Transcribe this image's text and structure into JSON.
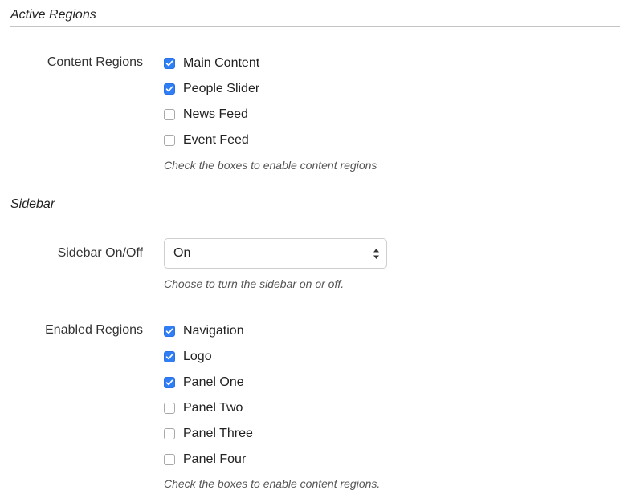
{
  "active_regions": {
    "title": "Active Regions",
    "content_regions": {
      "label": "Content Regions",
      "options": [
        {
          "label": "Main Content",
          "checked": true
        },
        {
          "label": "People Slider",
          "checked": true
        },
        {
          "label": "News Feed",
          "checked": false
        },
        {
          "label": "Event Feed",
          "checked": false
        }
      ],
      "help": "Check the boxes to enable content regions"
    }
  },
  "sidebar": {
    "title": "Sidebar",
    "toggle": {
      "label": "Sidebar On/Off",
      "value": "On",
      "help": "Choose to turn the sidebar on or off."
    },
    "enabled_regions": {
      "label": "Enabled Regions",
      "options": [
        {
          "label": "Navigation",
          "checked": true
        },
        {
          "label": "Logo",
          "checked": true
        },
        {
          "label": "Panel One",
          "checked": true
        },
        {
          "label": "Panel Two",
          "checked": false
        },
        {
          "label": "Panel Three",
          "checked": false
        },
        {
          "label": "Panel Four",
          "checked": false
        }
      ],
      "help": "Check the boxes to enable content regions."
    }
  },
  "colors": {
    "checkbox_checked": "#2f7ef6",
    "rule": "#c4c4c4"
  },
  "icons": {
    "checkmark": "checkmark-icon",
    "select_arrows": "up-down-arrows-icon"
  }
}
